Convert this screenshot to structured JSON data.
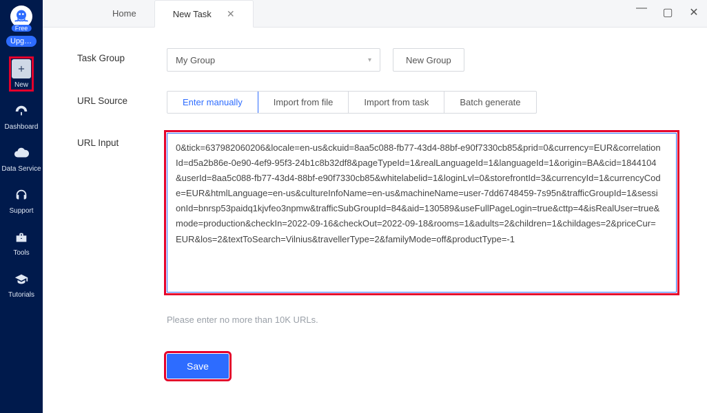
{
  "sidebar": {
    "free_badge": "Free",
    "upgrade": "Upg…",
    "items": [
      {
        "label": "New"
      },
      {
        "label": "Dashboard"
      },
      {
        "label": "Data Service"
      },
      {
        "label": "Support"
      },
      {
        "label": "Tools"
      },
      {
        "label": "Tutorials"
      }
    ]
  },
  "tabs": {
    "home": "Home",
    "active": "New Task"
  },
  "form": {
    "task_group_label": "Task Group",
    "task_group_value": "My Group",
    "new_group_btn": "New Group",
    "url_source_label": "URL Source",
    "url_source_options": [
      "Enter manually",
      "Import from file",
      "Import from task",
      "Batch generate"
    ],
    "url_input_label": "URL Input",
    "url_input_value": "0&tick=637982060206&locale=en-us&ckuid=8aa5c088-fb77-43d4-88bf-e90f7330cb85&prid=0&currency=EUR&correlationId=d5a2b86e-0e90-4ef9-95f3-24b1c8b32df8&pageTypeId=1&realLanguageId=1&languageId=1&origin=BA&cid=1844104&userId=8aa5c088-fb77-43d4-88bf-e90f7330cb85&whitelabelid=1&loginLvl=0&storefrontId=3&currencyId=1&currencyCode=EUR&htmlLanguage=en-us&cultureInfoName=en-us&machineName=user-7dd6748459-7s95n&trafficGroupId=1&sessionId=bnrsp53paidq1kjvfeo3npmw&trafficSubGroupId=84&aid=130589&useFullPageLogin=true&cttp=4&isRealUser=true&mode=production&checkIn=2022-09-16&checkOut=2022-09-18&rooms=1&adults=2&children=1&childages=2&priceCur=EUR&los=2&textToSearch=Vilnius&travellerType=2&familyMode=off&productType=-1",
    "url_input_hint": "Please enter no more than 10K URLs.",
    "save_btn": "Save"
  }
}
